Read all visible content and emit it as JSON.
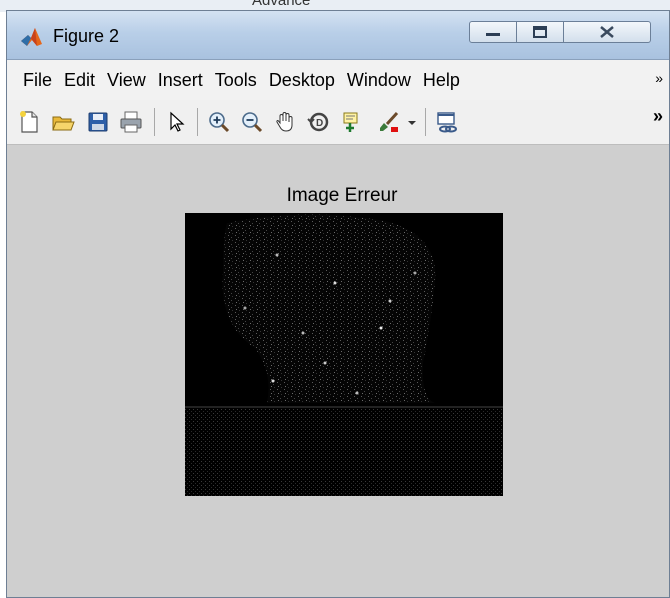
{
  "window": {
    "title": "Figure 2",
    "behind_text": "Advance"
  },
  "menu": {
    "items": [
      "File",
      "Edit",
      "View",
      "Insert",
      "Tools",
      "Desktop",
      "Window",
      "Help"
    ],
    "overflow": "»"
  },
  "toolbar": {
    "icons": [
      "new-figure-icon",
      "open-file-icon",
      "save-icon",
      "print-icon",
      "pointer-icon",
      "zoom-in-icon",
      "zoom-out-icon",
      "pan-hand-icon",
      "rotate-3d-icon",
      "data-cursor-icon",
      "brush-icon",
      "dropdown-arrow-icon",
      "link-plot-icon"
    ],
    "overflow": "»"
  },
  "figure": {
    "title": "Image Erreur"
  },
  "colors": {
    "figure_bg": "#cfcfcf",
    "titlebar": "#b9cfe8",
    "image_bg": "#000000"
  }
}
